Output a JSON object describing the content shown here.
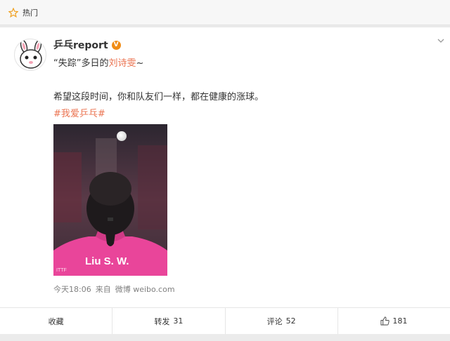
{
  "topbar": {
    "label": "热门",
    "icon": "star-icon"
  },
  "post": {
    "author": "乒乓report",
    "verified_badge": "V",
    "line1_part1": "“失踪”多日的",
    "line1_name": "刘诗雯",
    "line1_tail": "~",
    "line2": "希望这段时间，你和队友们一样，都在健康的涨球。",
    "hashtag": "#我爱乒乓#",
    "photo_text": "Liu S. W.",
    "photo_watermark": "ITTF",
    "time": "今天18:06",
    "source_prefix": "来自",
    "source": "微博 weibo.com"
  },
  "actions": {
    "collect": "收藏",
    "repost": "转发",
    "repost_count": "31",
    "comment": "评论",
    "comment_count": "52",
    "like_count": "181"
  },
  "colors": {
    "accent": "#eb7350",
    "link": "#eb7350",
    "badge": "#f08c16"
  }
}
